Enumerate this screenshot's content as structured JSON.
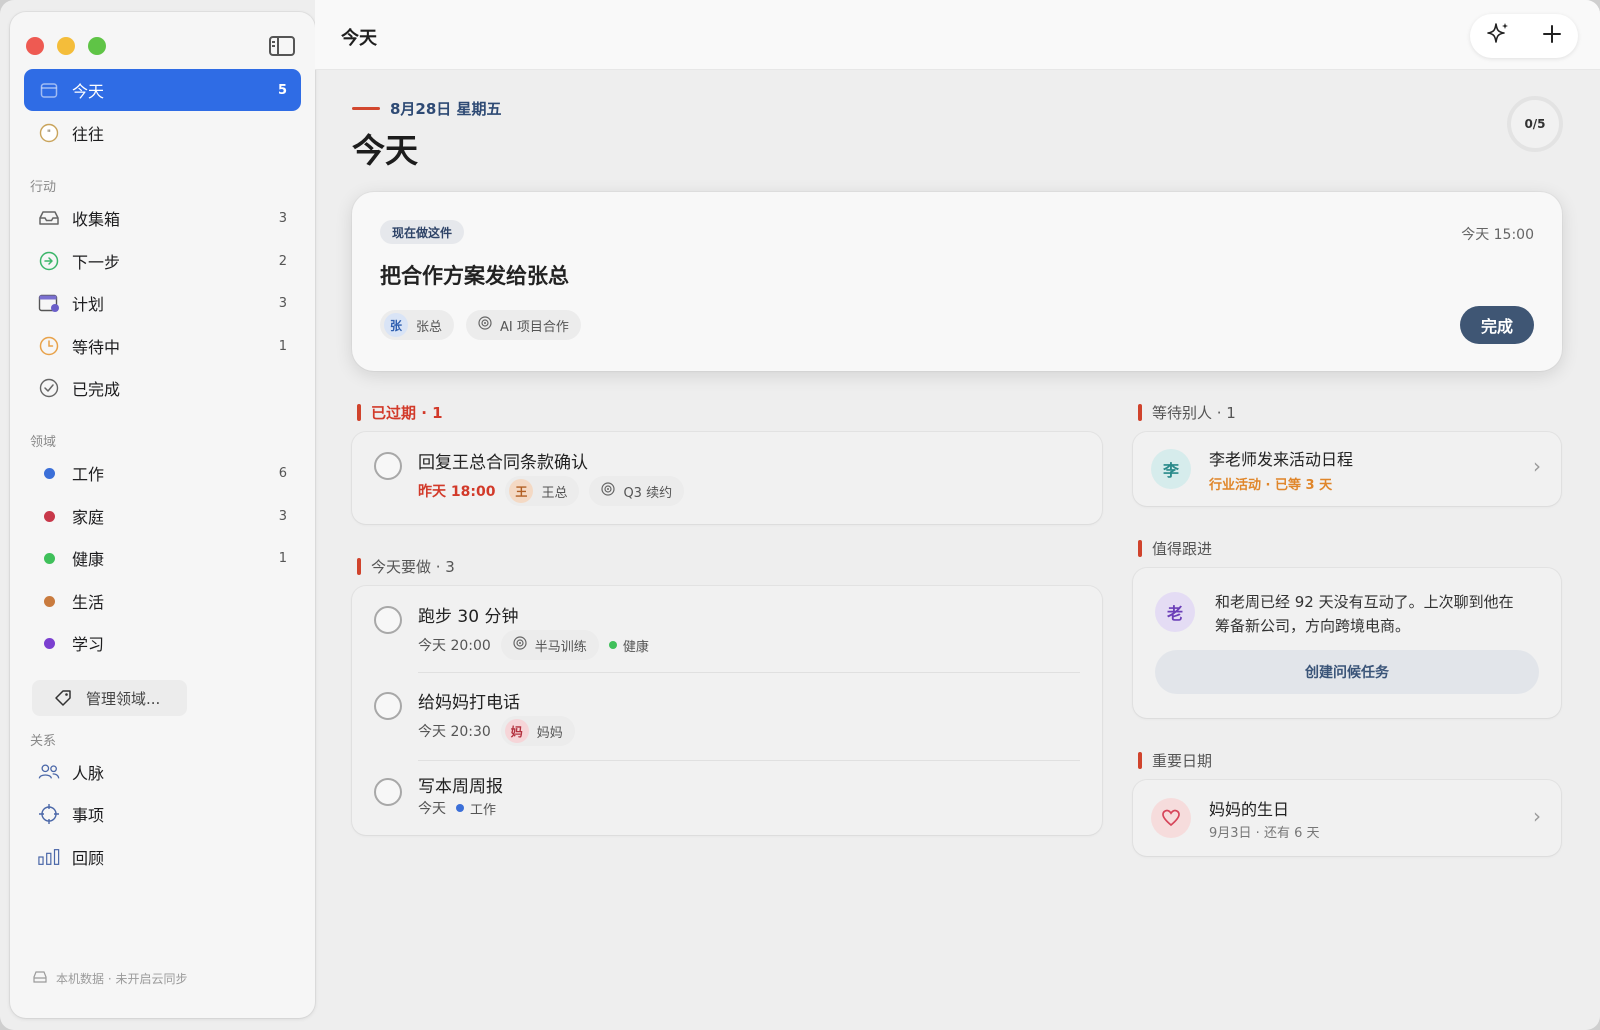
{
  "sidebar": {
    "nav_top": [
      {
        "label": "今天",
        "count": "5"
      },
      {
        "label": "往往",
        "count": ""
      }
    ],
    "section_actions": "行动",
    "actions": [
      {
        "label": "收集箱",
        "count": "3"
      },
      {
        "label": "下一步",
        "count": "2"
      },
      {
        "label": "计划",
        "count": "3"
      },
      {
        "label": "等待中",
        "count": "1"
      },
      {
        "label": "已完成",
        "count": ""
      }
    ],
    "section_areas": "领域",
    "areas": [
      {
        "label": "工作",
        "count": "6",
        "color": "#3b6fd8"
      },
      {
        "label": "家庭",
        "count": "3",
        "color": "#c8384a"
      },
      {
        "label": "健康",
        "count": "1",
        "color": "#3fc05a"
      },
      {
        "label": "生活",
        "count": "",
        "color": "#c97b3e"
      },
      {
        "label": "学习",
        "count": "",
        "color": "#7b3fd0"
      }
    ],
    "manage_label": "管理领域...",
    "section_relations": "关系",
    "relations": [
      {
        "label": "人脉"
      },
      {
        "label": "事项"
      },
      {
        "label": "回顾"
      }
    ],
    "footer": "本机数据 · 未开启云同步"
  },
  "topbar": {
    "title": "今天"
  },
  "header": {
    "date": "8月28日 星期五",
    "title": "今天",
    "progress": "0/5"
  },
  "focus": {
    "badge": "现在做这件",
    "time": "今天 15:00",
    "title": "把合作方案发给张总",
    "person_initial": "张",
    "person": "张总",
    "project": "AI 项目合作",
    "done_label": "完成"
  },
  "overdue": {
    "heading": "已过期 · 1",
    "tasks": [
      {
        "title": "回复王总合同条款确认",
        "time": "昨天 18:00",
        "person_initial": "王",
        "person": "王总",
        "project": "Q3 续约"
      }
    ]
  },
  "today": {
    "heading": "今天要做 · 3",
    "tasks": [
      {
        "title": "跑步 30 分钟",
        "time": "今天 20:00",
        "project": "半马训练",
        "area": "健康"
      },
      {
        "title": "给妈妈打电话",
        "time": "今天 20:30",
        "person_initial": "妈",
        "person": "妈妈"
      },
      {
        "title": "写本周周报",
        "time": "今天",
        "area": "工作"
      }
    ]
  },
  "waiting": {
    "heading": "等待别人 · 1",
    "item": {
      "initial": "李",
      "title": "李老师发来活动日程",
      "sub": "行业活动 · 已等 3 天"
    }
  },
  "followup": {
    "heading": "值得跟进",
    "item": {
      "initial": "老",
      "text_line1": "和老周已经 92 天没有互动了。上次聊到他在",
      "text_line2": "筹备新公司，方向跨境电商。",
      "cta": "创建问候任务"
    }
  },
  "dates": {
    "heading": "重要日期",
    "item": {
      "title": "妈妈的生日",
      "sub": "9月3日 · 还有 6 天"
    }
  },
  "colors": {
    "accent": "#2f6ce5",
    "overdue": "#d23a2a",
    "done_button": "#3f5674",
    "section_bar": "#d0432c",
    "waiting_sub": "#e0862a"
  }
}
